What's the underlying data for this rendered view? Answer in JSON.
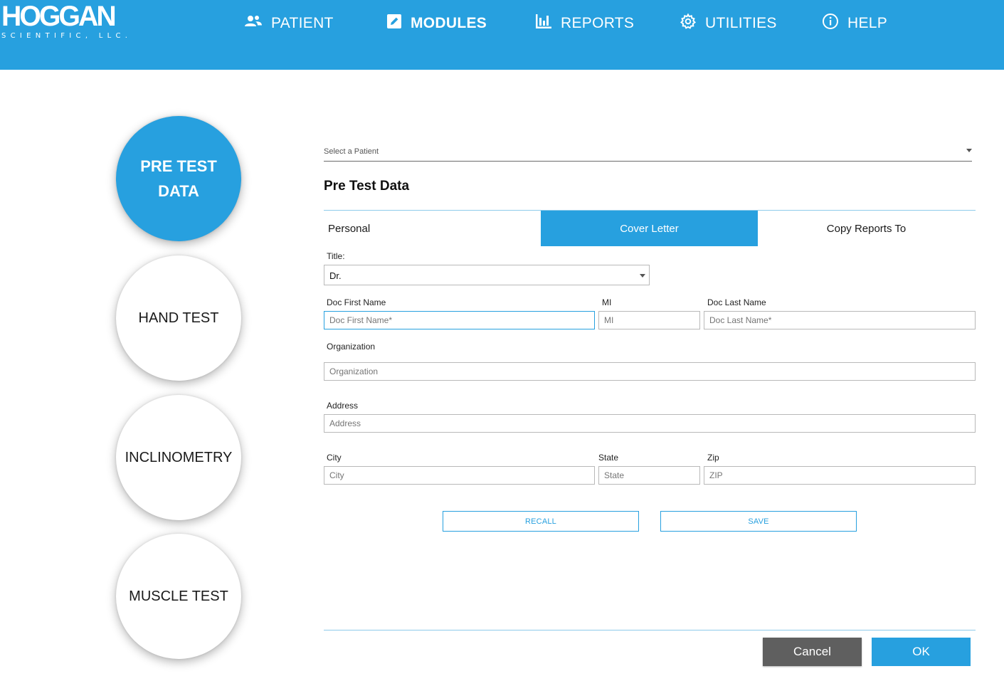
{
  "app": {
    "logo_main": "HOGGAN",
    "logo_sub": "SCIENTIFIC, LLC."
  },
  "nav": [
    {
      "label": "PATIENT",
      "icon": "users-icon",
      "active": false
    },
    {
      "label": "MODULES",
      "icon": "edit-icon",
      "active": true
    },
    {
      "label": "REPORTS",
      "icon": "bar-chart-icon",
      "active": false
    },
    {
      "label": "UTILITIES",
      "icon": "gear-icon",
      "active": false
    },
    {
      "label": "HELP",
      "icon": "info-icon",
      "active": false
    }
  ],
  "modules": [
    {
      "label": "PRE TEST DATA",
      "active": true
    },
    {
      "label": "HAND TEST",
      "active": false
    },
    {
      "label": "INCLINOMETRY",
      "active": false
    },
    {
      "label": "MUSCLE TEST",
      "active": false
    }
  ],
  "patient_select": {
    "placeholder": "Select a Patient"
  },
  "section_title": "Pre Test Data",
  "tabs": [
    {
      "label": "Personal",
      "active": false
    },
    {
      "label": "Cover Letter",
      "active": true
    },
    {
      "label": "Copy Reports To",
      "active": false
    }
  ],
  "form": {
    "title_label": "Title:",
    "title_value": "Dr.",
    "first_name_label": "Doc First Name",
    "first_name_placeholder": "Doc First Name*",
    "mi_label": "MI",
    "mi_placeholder": "MI",
    "last_name_label": "Doc Last Name",
    "last_name_placeholder": "Doc Last Name*",
    "organization_label": "Organization",
    "organization_placeholder": "Organization",
    "address_label": "Address",
    "address_placeholder": "Address",
    "city_label": "City",
    "city_placeholder": "City",
    "state_label": "State",
    "state_placeholder": "State",
    "zip_label": "Zip",
    "zip_placeholder": "ZIP"
  },
  "actions": {
    "recall": "RECALL",
    "save": "SAVE",
    "cancel": "Cancel",
    "ok": "OK"
  },
  "colors": {
    "accent": "#27a0df",
    "cancel": "#5f5f5f"
  }
}
